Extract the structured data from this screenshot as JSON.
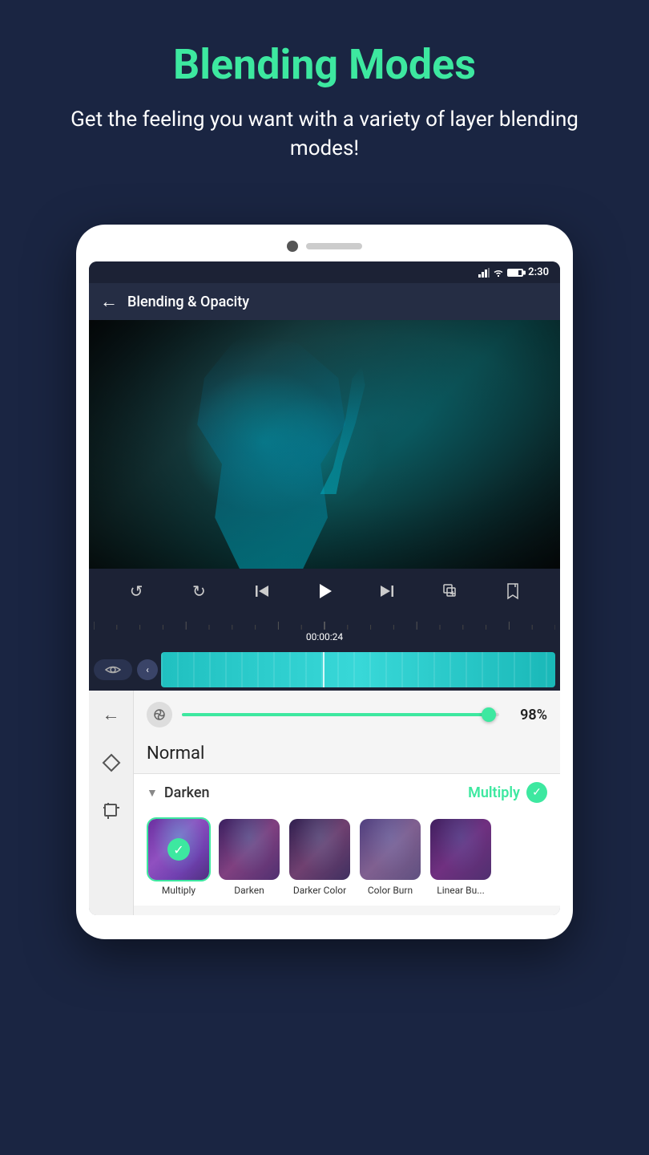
{
  "header": {
    "title": "Blending Modes",
    "subtitle": "Get the feeling you want with a variety of layer blending modes!"
  },
  "status_bar": {
    "time": "2:30"
  },
  "app_bar": {
    "title": "Blending & Opacity",
    "back_label": "←"
  },
  "playback": {
    "time_display": "00:00:24"
  },
  "opacity": {
    "icon": "◎",
    "value": "98%",
    "slider_fill_width": "98%"
  },
  "blend_mode": {
    "current_label": "Normal",
    "section_name": "Darken",
    "active_mode": "Multiply"
  },
  "blend_thumbnails": [
    {
      "id": "multiply",
      "label": "Multiply",
      "selected": true,
      "bg_class": ""
    },
    {
      "id": "darken",
      "label": "Darken",
      "selected": false,
      "bg_class": "darken"
    },
    {
      "id": "darker-color",
      "label": "Darker Color",
      "selected": false,
      "bg_class": "darker-color"
    },
    {
      "id": "color-burn",
      "label": "Color Burn",
      "selected": false,
      "bg_class": "color-burn"
    },
    {
      "id": "linear-burn",
      "label": "Linear Bu...",
      "selected": false,
      "bg_class": "linear-burn"
    }
  ],
  "controls": {
    "undo_label": "↺",
    "redo_label": "↻",
    "skip_start_label": "|◀",
    "play_label": "▶",
    "skip_end_label": "▶|",
    "add_clip_label": "⊞",
    "bookmark_label": "🔖",
    "back_label": "←",
    "eye_label": "👁",
    "collapse_label": "‹"
  }
}
